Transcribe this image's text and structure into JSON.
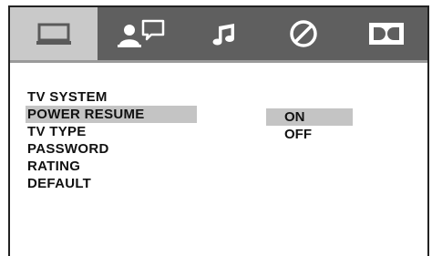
{
  "tabs": [
    {
      "icon": "tv-screen-icon",
      "active": true
    },
    {
      "icon": "person-speech-icon",
      "active": false
    },
    {
      "icon": "music-note-icon",
      "active": false
    },
    {
      "icon": "no-sign-icon",
      "active": false
    },
    {
      "icon": "dolby-icon",
      "active": false
    }
  ],
  "menu": {
    "items": [
      {
        "label": "TV SYSTEM"
      },
      {
        "label": "POWER RESUME",
        "selected": true
      },
      {
        "label": "TV TYPE"
      },
      {
        "label": "PASSWORD"
      },
      {
        "label": "RATING"
      },
      {
        "label": "DEFAULT"
      }
    ]
  },
  "options": {
    "items": [
      {
        "label": "ON",
        "selected": true
      },
      {
        "label": "OFF"
      }
    ]
  },
  "colors": {
    "tabbar": "#5f5f5f",
    "active_tab": "#c9c9c9",
    "highlight": "#c4c4c4",
    "icon": "#ffffff",
    "active_icon": "#5a5a5a"
  }
}
